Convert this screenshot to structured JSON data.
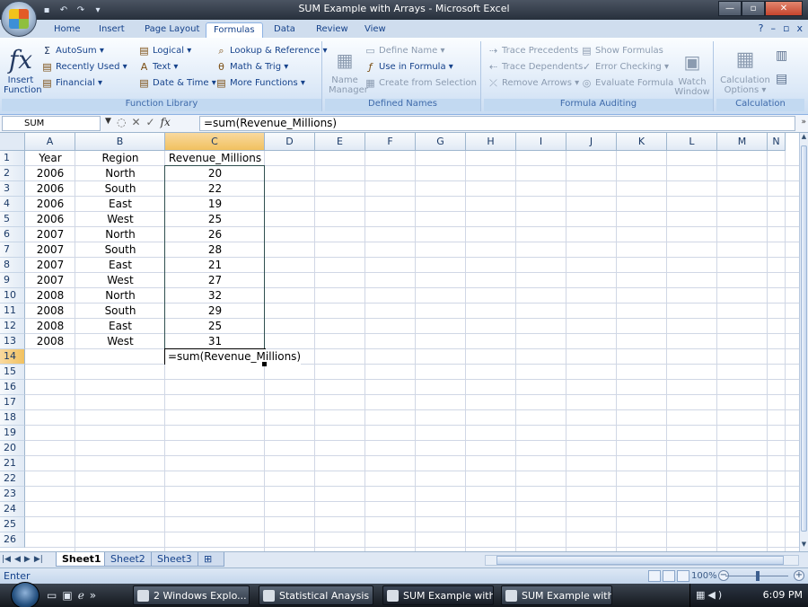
{
  "window": {
    "title": "SUM Example with Arrays - Microsoft Excel",
    "min_glyph": "—",
    "max_glyph": "▫",
    "close_glyph": "✕"
  },
  "qat": [
    "save-icon",
    "undo-icon",
    "redo-icon",
    "customize-icon"
  ],
  "tabs": [
    "Home",
    "Insert",
    "Page Layout",
    "Formulas",
    "Data",
    "Review",
    "View"
  ],
  "active_tab": "Formulas",
  "tab_help_glyphs": [
    "?",
    "–",
    "▫",
    "x"
  ],
  "ribbon": {
    "function_library": {
      "label": "Function Library",
      "insert_function": "Insert\nFunction",
      "autosum": "AutoSum ▾",
      "recently_used": "Recently Used ▾",
      "financial": "Financial ▾",
      "logical": "Logical ▾",
      "text": "Text ▾",
      "date_time": "Date & Time ▾",
      "lookup_reference": "Lookup & Reference ▾",
      "math_trig": "Math & Trig ▾",
      "more_functions": "More Functions ▾"
    },
    "defined_names": {
      "label": "Defined Names",
      "name_manager": "Name\nManager",
      "define_name": "Define Name ▾",
      "use_in_formula": "Use in Formula ▾",
      "create_from_selection": "Create from Selection"
    },
    "formula_auditing": {
      "label": "Formula Auditing",
      "trace_precedents": "Trace Precedents",
      "trace_dependents": "Trace Dependents",
      "remove_arrows": "Remove Arrows ▾",
      "show_formulas": "Show Formulas",
      "error_checking": "Error Checking ▾",
      "evaluate_formula": "Evaluate Formula",
      "watch_window": "Watch\nWindow"
    },
    "calculation": {
      "label": "Calculation",
      "calculation_options": "Calculation\nOptions ▾"
    }
  },
  "formula_bar": {
    "name_box": "SUM",
    "cancel": "✕",
    "enter": "✓",
    "fx": "fx",
    "formula": "=sum(Revenue_Millions)"
  },
  "columns": [
    "A",
    "B",
    "C",
    "D",
    "E",
    "F",
    "G",
    "H",
    "I",
    "J",
    "K",
    "L",
    "M",
    "N"
  ],
  "rows": [
    "1",
    "2",
    "3",
    "4",
    "5",
    "6",
    "7",
    "8",
    "9",
    "10",
    "11",
    "12",
    "13",
    "14",
    "15",
    "16",
    "17",
    "18",
    "19",
    "20",
    "21",
    "22",
    "23",
    "24",
    "25",
    "26"
  ],
  "sheet": {
    "headers": [
      "Year",
      "Region",
      "Revenue_Millions"
    ],
    "data": [
      [
        "2006",
        "North",
        "20"
      ],
      [
        "2006",
        "South",
        "22"
      ],
      [
        "2006",
        "East",
        "19"
      ],
      [
        "2006",
        "West",
        "25"
      ],
      [
        "2007",
        "North",
        "26"
      ],
      [
        "2007",
        "South",
        "28"
      ],
      [
        "2007",
        "East",
        "21"
      ],
      [
        "2007",
        "West",
        "27"
      ],
      [
        "2008",
        "North",
        "32"
      ],
      [
        "2008",
        "South",
        "29"
      ],
      [
        "2008",
        "East",
        "25"
      ],
      [
        "2008",
        "West",
        "31"
      ]
    ],
    "editing_cell": "=sum(Revenue_Millions)"
  },
  "sheet_tabs": [
    "Sheet1",
    "Sheet2",
    "Sheet3"
  ],
  "active_sheet": "Sheet1",
  "status": {
    "mode": "Enter",
    "zoom": "100%"
  },
  "taskbar": {
    "items": [
      "2 Windows Explo...",
      "Statistical Anaysis ...",
      "SUM Example with ...",
      "SUM Example with ..."
    ],
    "active_index": 2,
    "clock": "6:09 PM"
  }
}
